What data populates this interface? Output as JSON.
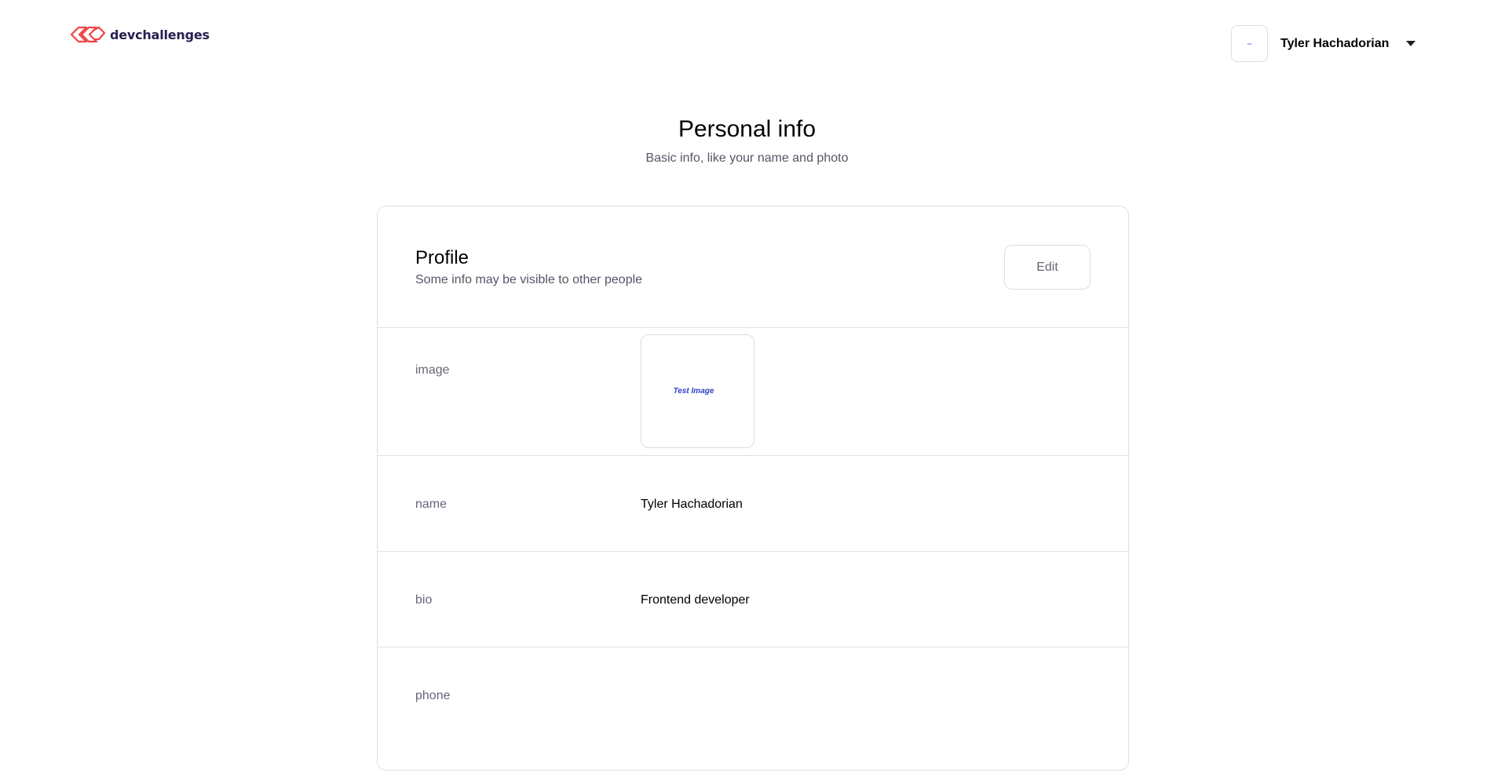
{
  "header": {
    "brand": "devchallenges",
    "brand_color": "#282051",
    "logo_color": "#ef4444",
    "user_name": "Tyler Hachadorian",
    "avatar_icon": "user-avatar-image",
    "menu_icon": "caret-down-icon"
  },
  "page": {
    "title": "Personal info",
    "subtitle": "Basic info, like your name and photo"
  },
  "profile": {
    "title": "Profile",
    "subtitle": "Some info may be visible to other people",
    "edit_label": "Edit",
    "fields": {
      "image": {
        "label": "image",
        "image_text": "Test Image"
      },
      "name": {
        "label": "name",
        "value": "Tyler Hachadorian"
      },
      "bio": {
        "label": "bio",
        "value": "Frontend developer"
      },
      "phone": {
        "label": "phone",
        "value": ""
      }
    }
  }
}
